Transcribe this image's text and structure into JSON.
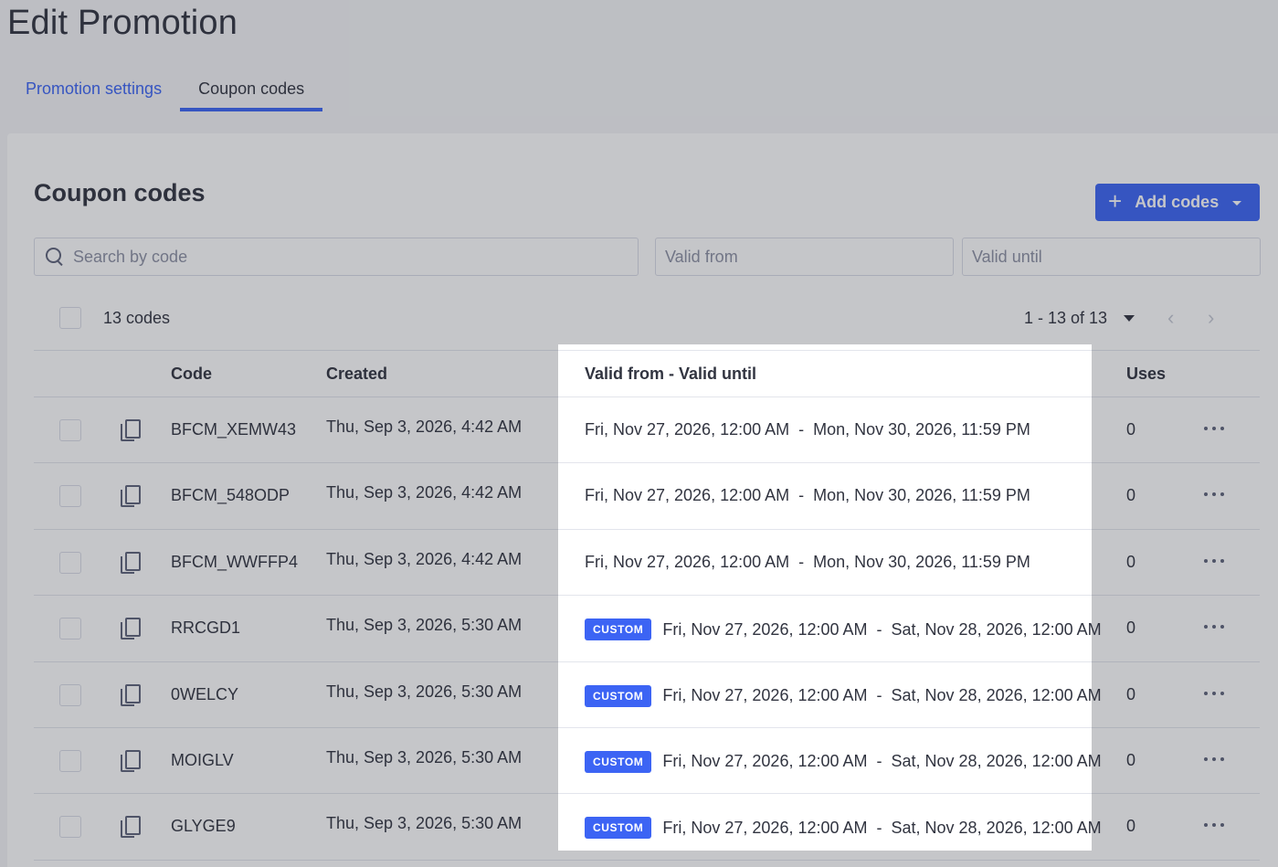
{
  "page": {
    "title": "Edit Promotion"
  },
  "tabs": [
    {
      "label": "Promotion settings",
      "active": false
    },
    {
      "label": "Coupon codes",
      "active": true
    }
  ],
  "card": {
    "title": "Coupon codes",
    "add_button": {
      "label": "Add codes",
      "icon": "plus-icon",
      "dropdown_icon": "caret-down-icon"
    }
  },
  "filters": {
    "search_placeholder": "Search by code",
    "valid_from_placeholder": "Valid from",
    "valid_until_placeholder": "Valid until"
  },
  "summary": {
    "count_label": "13 codes",
    "pagination": "1 - 13 of 13"
  },
  "table": {
    "headers": {
      "code": "Code",
      "created": "Created",
      "valid": "Valid from - Valid until",
      "uses": "Uses"
    },
    "rows": [
      {
        "code": "BFCM_XEMW43",
        "created": "Thu, Sep 3, 2026, 4:42 AM",
        "badge": "",
        "valid_from": "Fri, Nov 27, 2026, 12:00 AM",
        "valid_until": "Mon, Nov 30, 2026, 11:59 PM",
        "uses": "0"
      },
      {
        "code": "BFCM_548ODP",
        "created": "Thu, Sep 3, 2026, 4:42 AM",
        "badge": "",
        "valid_from": "Fri, Nov 27, 2026, 12:00 AM",
        "valid_until": "Mon, Nov 30, 2026, 11:59 PM",
        "uses": "0"
      },
      {
        "code": "BFCM_WWFFP4",
        "created": "Thu, Sep 3, 2026, 4:42 AM",
        "badge": "",
        "valid_from": "Fri, Nov 27, 2026, 12:00 AM",
        "valid_until": "Mon, Nov 30, 2026, 11:59 PM",
        "uses": "0"
      },
      {
        "code": "RRCGD1",
        "created": "Thu, Sep 3, 2026, 5:30 AM",
        "badge": "CUSTOM",
        "valid_from": "Fri, Nov 27, 2026, 12:00 AM",
        "valid_until": "Sat, Nov 28, 2026, 12:00 AM",
        "uses": "0"
      },
      {
        "code": "0WELCY",
        "created": "Thu, Sep 3, 2026, 5:30 AM",
        "badge": "CUSTOM",
        "valid_from": "Fri, Nov 27, 2026, 12:00 AM",
        "valid_until": "Sat, Nov 28, 2026, 12:00 AM",
        "uses": "0"
      },
      {
        "code": "MOIGLV",
        "created": "Thu, Sep 3, 2026, 5:30 AM",
        "badge": "CUSTOM",
        "valid_from": "Fri, Nov 27, 2026, 12:00 AM",
        "valid_until": "Sat, Nov 28, 2026, 12:00 AM",
        "uses": "0"
      },
      {
        "code": "GLYGE9",
        "created": "Thu, Sep 3, 2026, 5:30 AM",
        "badge": "CUSTOM",
        "valid_from": "Fri, Nov 27, 2026, 12:00 AM",
        "valid_until": "Sat, Nov 28, 2026, 12:00 AM",
        "uses": "0"
      }
    ],
    "date_separator": "-"
  },
  "colors": {
    "accent": "#3c64f4",
    "text": "#313440",
    "muted": "#8c90a3"
  }
}
